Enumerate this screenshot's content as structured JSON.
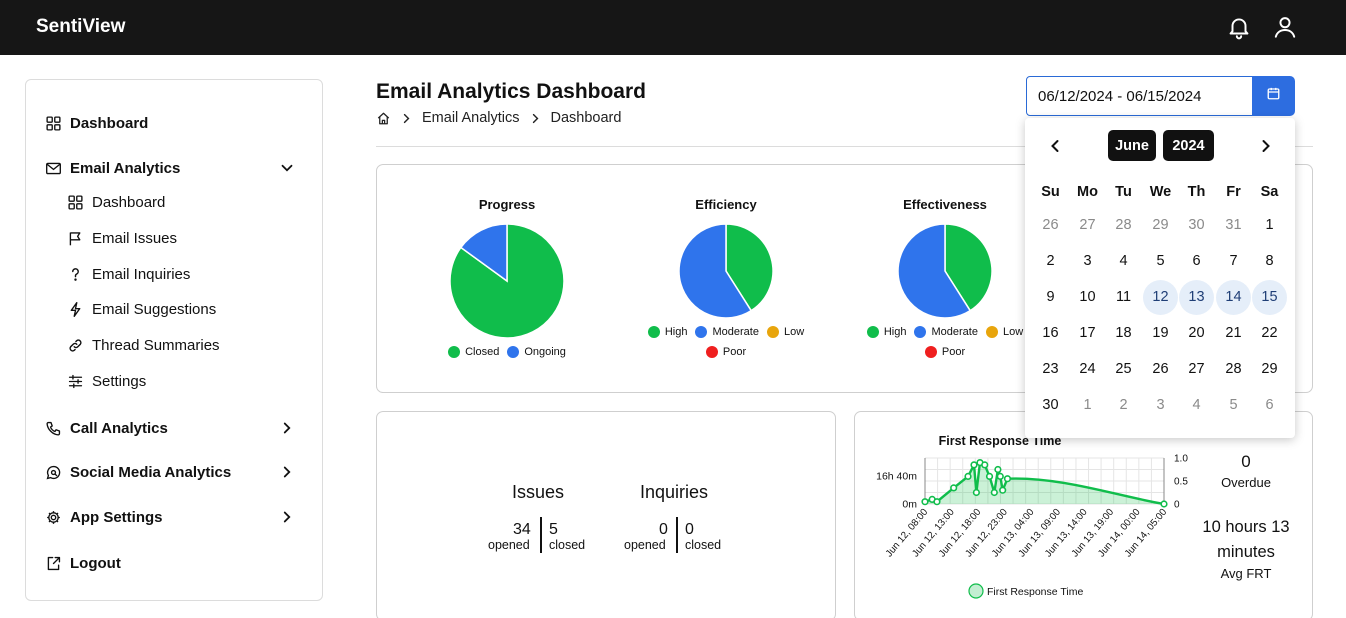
{
  "app": {
    "brand": "SentiView"
  },
  "sidebar": {
    "items": [
      {
        "label": "Dashboard",
        "icon": "grid-icon"
      },
      {
        "label": "Email Analytics",
        "icon": "mail-icon",
        "expanded": true,
        "children": [
          {
            "label": "Dashboard",
            "icon": "grid-icon"
          },
          {
            "label": "Email Issues",
            "icon": "flag-icon"
          },
          {
            "label": "Email Inquiries",
            "icon": "question-icon"
          },
          {
            "label": "Email Suggestions",
            "icon": "lightning-icon"
          },
          {
            "label": "Thread Summaries",
            "icon": "link-icon"
          },
          {
            "label": "Settings",
            "icon": "sliders-icon"
          }
        ]
      },
      {
        "label": "Call Analytics",
        "icon": "phone-icon"
      },
      {
        "label": "Social Media Analytics",
        "icon": "chat-search-icon"
      },
      {
        "label": "App Settings",
        "icon": "gear-icon"
      },
      {
        "label": "Logout",
        "icon": "logout-icon"
      }
    ]
  },
  "header": {
    "title": "Email Analytics Dashboard",
    "breadcrumb": [
      "Email Analytics",
      "Dashboard"
    ]
  },
  "date_range": {
    "value": "06/12/2024 - 06/15/2024"
  },
  "calendar": {
    "month": "June",
    "year": "2024",
    "weekdays": [
      "Su",
      "Mo",
      "Tu",
      "We",
      "Th",
      "Fr",
      "Sa"
    ],
    "weeks": [
      [
        "26",
        "27",
        "28",
        "29",
        "30",
        "31",
        "1"
      ],
      [
        "2",
        "3",
        "4",
        "5",
        "6",
        "7",
        "8"
      ],
      [
        "9",
        "10",
        "11",
        "12",
        "13",
        "14",
        "15"
      ],
      [
        "16",
        "17",
        "18",
        "19",
        "20",
        "21",
        "22"
      ],
      [
        "23",
        "24",
        "25",
        "26",
        "27",
        "28",
        "29"
      ],
      [
        "30",
        "1",
        "2",
        "3",
        "4",
        "5",
        "6"
      ]
    ],
    "selected": [
      "12",
      "13",
      "14",
      "15"
    ]
  },
  "colors": {
    "green": "#10bd4b",
    "blue": "#2f74ec",
    "amber": "#e8a50c",
    "red": "#ef1f1f",
    "topbar": "#161616",
    "accent": "#2d6de0"
  },
  "pies": [
    {
      "title": "Progress",
      "legend": [
        "Closed",
        "Ongoing"
      ]
    },
    {
      "title": "Efficiency",
      "legend": [
        "High",
        "Moderate",
        "Low",
        "Poor"
      ]
    },
    {
      "title": "Effectiveness",
      "legend": [
        "High",
        "Moderate",
        "Low",
        "Poor"
      ]
    }
  ],
  "stats": {
    "issues": {
      "title": "Issues",
      "opened": "34",
      "opened_label": "opened",
      "closed": "5",
      "closed_label": "closed"
    },
    "inquiries": {
      "title": "Inquiries",
      "opened": "0",
      "opened_label": "opened",
      "closed": "0",
      "closed_label": "closed"
    }
  },
  "frt": {
    "overdue_value": "0",
    "overdue_label": "Overdue",
    "avg_value_line1": "10 hours 13",
    "avg_value_line2": "minutes",
    "avg_label": "Avg FRT"
  },
  "chart_data": [
    {
      "type": "pie",
      "title": "Progress",
      "slices": [
        {
          "label": "Closed",
          "value": 34
        },
        {
          "label": "Ongoing",
          "value": 6
        }
      ]
    },
    {
      "type": "pie",
      "title": "Efficiency",
      "slices": [
        {
          "label": "High",
          "value": 41
        },
        {
          "label": "Moderate",
          "value": 59
        },
        {
          "label": "Low",
          "value": 0
        },
        {
          "label": "Poor",
          "value": 0
        }
      ]
    },
    {
      "type": "pie",
      "title": "Effectiveness",
      "slices": [
        {
          "label": "High",
          "value": 41
        },
        {
          "label": "Moderate",
          "value": 59
        },
        {
          "label": "Low",
          "value": 0
        },
        {
          "label": "Poor",
          "value": 0
        }
      ]
    },
    {
      "type": "area",
      "title": "First Response Time",
      "x_ticks": [
        "Jun 12, 08:00",
        "Jun 12, 13:00",
        "Jun 12, 18:00",
        "Jun 12, 23:00",
        "Jun 13, 04:00",
        "Jun 13, 09:00",
        "Jun 13, 14:00",
        "Jun 13, 19:00",
        "Jun 14, 00:00",
        "Jun 14, 05:00"
      ],
      "y_left_ticks": [
        "16h 40m",
        "0m"
      ],
      "y_right_ticks": [
        "1.0",
        "0.5",
        "0"
      ],
      "ylim_right": [
        0,
        1
      ],
      "series": [
        {
          "name": "First Response Time",
          "points": [
            {
              "x": 0.0,
              "y": 0.05
            },
            {
              "x": 0.03,
              "y": 0.1
            },
            {
              "x": 0.05,
              "y": 0.05
            },
            {
              "x": 0.12,
              "y": 0.35
            },
            {
              "x": 0.18,
              "y": 0.6
            },
            {
              "x": 0.205,
              "y": 0.85
            },
            {
              "x": 0.215,
              "y": 0.25
            },
            {
              "x": 0.23,
              "y": 0.9
            },
            {
              "x": 0.25,
              "y": 0.85
            },
            {
              "x": 0.27,
              "y": 0.6
            },
            {
              "x": 0.29,
              "y": 0.25
            },
            {
              "x": 0.305,
              "y": 0.75
            },
            {
              "x": 0.315,
              "y": 0.6
            },
            {
              "x": 0.325,
              "y": 0.3
            },
            {
              "x": 0.345,
              "y": 0.55
            },
            {
              "x": 1.0,
              "y": 0.0
            }
          ]
        }
      ],
      "legend_position": "bottom"
    }
  ]
}
